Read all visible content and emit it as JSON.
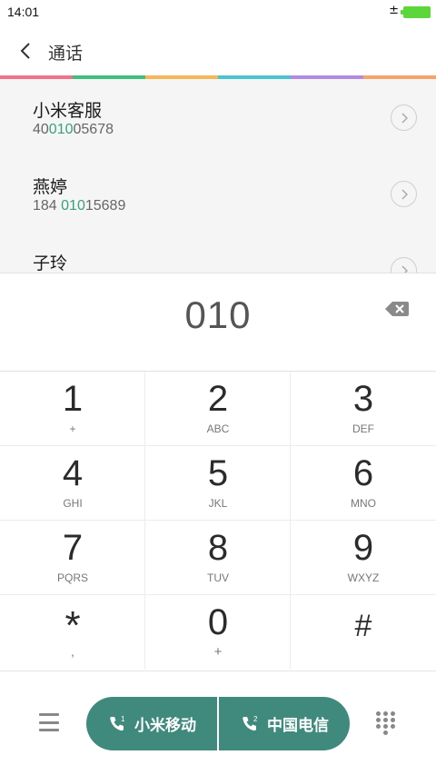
{
  "status_bar": {
    "time": "14:01",
    "charging_symbol": "±",
    "battery_color": "#5cd63a"
  },
  "header": {
    "title": "通话",
    "back_icon": "chevron-left-icon"
  },
  "accent_stripe_colors": [
    "#f0728a",
    "#3fc07a",
    "#f5b75a",
    "#4bc4d0",
    "#b18be0",
    "#f5a26b"
  ],
  "results": [
    {
      "name": "小米客服",
      "number_prefix": "40",
      "number_match": "010",
      "number_suffix": "05678"
    },
    {
      "name": "燕婷",
      "number_prefix": "184 ",
      "number_match": "010",
      "number_suffix": "15689"
    },
    {
      "name": "子玲",
      "number_prefix": "",
      "number_match": "",
      "number_suffix": ""
    }
  ],
  "dial_input": {
    "value": "010",
    "backspace_icon": "backspace-icon"
  },
  "keypad": [
    {
      "digit": "1",
      "sub": "+"
    },
    {
      "digit": "2",
      "sub": "ABC"
    },
    {
      "digit": "3",
      "sub": "DEF"
    },
    {
      "digit": "4",
      "sub": "GHI"
    },
    {
      "digit": "5",
      "sub": "JKL"
    },
    {
      "digit": "6",
      "sub": "MNO"
    },
    {
      "digit": "7",
      "sub": "PQRS"
    },
    {
      "digit": "8",
      "sub": "TUV"
    },
    {
      "digit": "9",
      "sub": "WXYZ"
    },
    {
      "digit": "*",
      "sub": ","
    },
    {
      "digit": "0",
      "sub": "+"
    },
    {
      "digit": "#",
      "sub": ""
    }
  ],
  "bottom_bar": {
    "call_sim1": {
      "sim": "1",
      "label": "小米移动"
    },
    "call_sim2": {
      "sim": "2",
      "label": "中国电信"
    },
    "call_button_color": "#3f8a7d",
    "highlight_color": "#3aa17a"
  }
}
